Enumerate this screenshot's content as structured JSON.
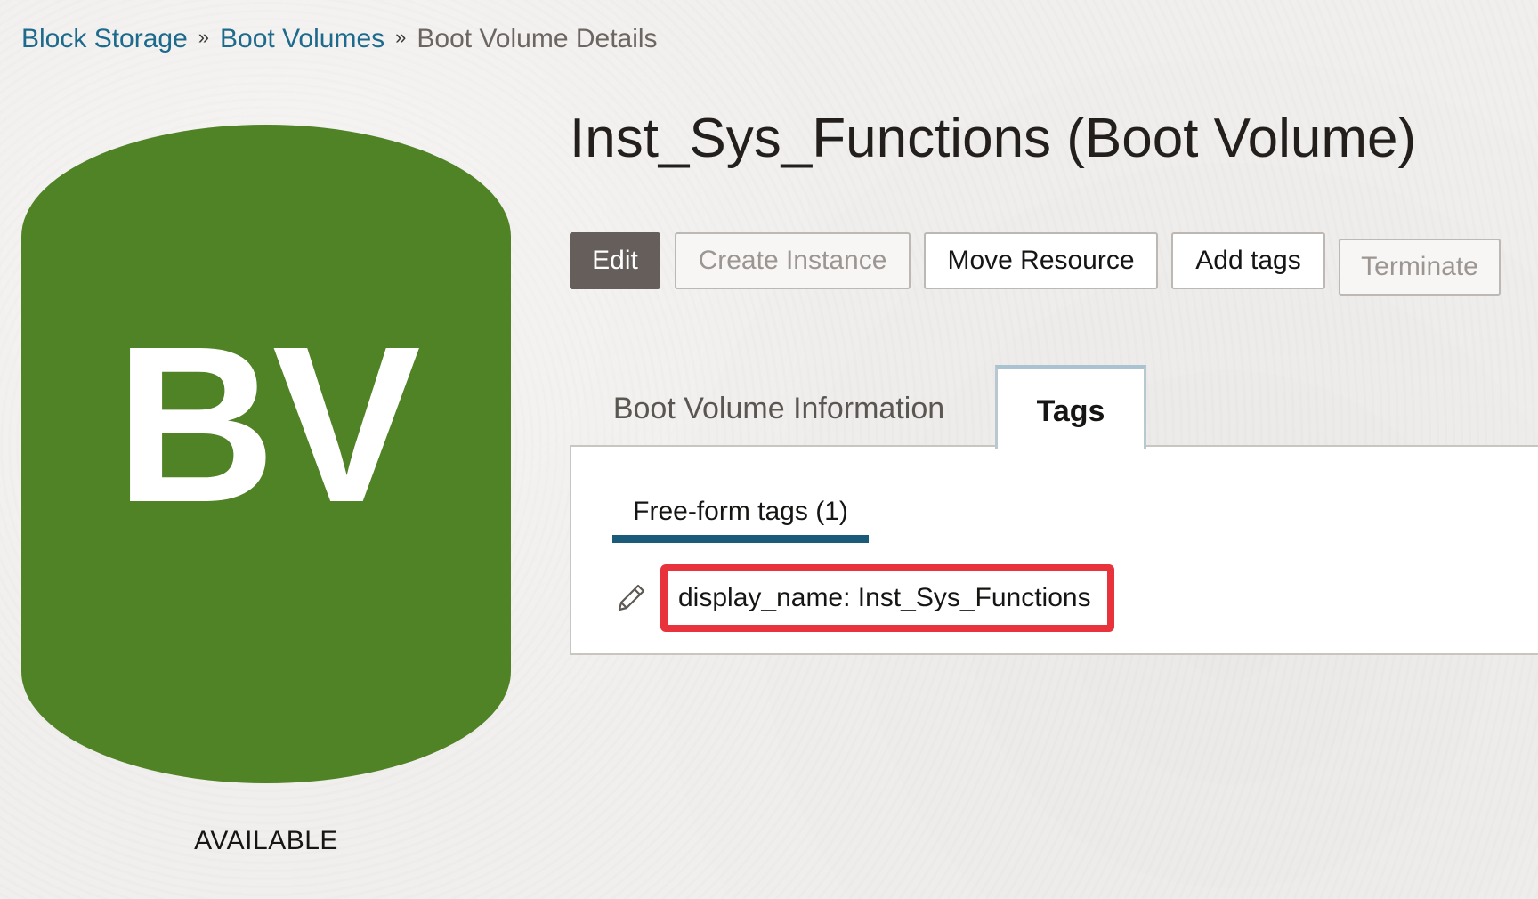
{
  "breadcrumb": {
    "items": [
      "Block Storage",
      "Boot Volumes"
    ],
    "current": "Boot Volume Details",
    "separator": "»"
  },
  "resource": {
    "abbreviation": "BV",
    "status": "AVAILABLE",
    "icon_color": "#508226"
  },
  "page": {
    "title": "Inst_Sys_Functions (Boot Volume)"
  },
  "actions": {
    "edit": "Edit",
    "create_instance": "Create Instance",
    "move_resource": "Move Resource",
    "add_tags": "Add tags",
    "terminate": "Terminate"
  },
  "tabs": [
    {
      "label": "Boot Volume Information",
      "active": false
    },
    {
      "label": "Tags",
      "active": true
    }
  ],
  "tags_panel": {
    "subtab_label": "Free-form tags (1)",
    "tags": [
      {
        "text": "display_name: Inst_Sys_Functions",
        "icon": "pencil-icon"
      }
    ]
  },
  "colors": {
    "link": "#1c6a8c",
    "primary_button": "#655e5a",
    "subtab_underline": "#1a5b7a",
    "highlight": "#e8323c"
  }
}
